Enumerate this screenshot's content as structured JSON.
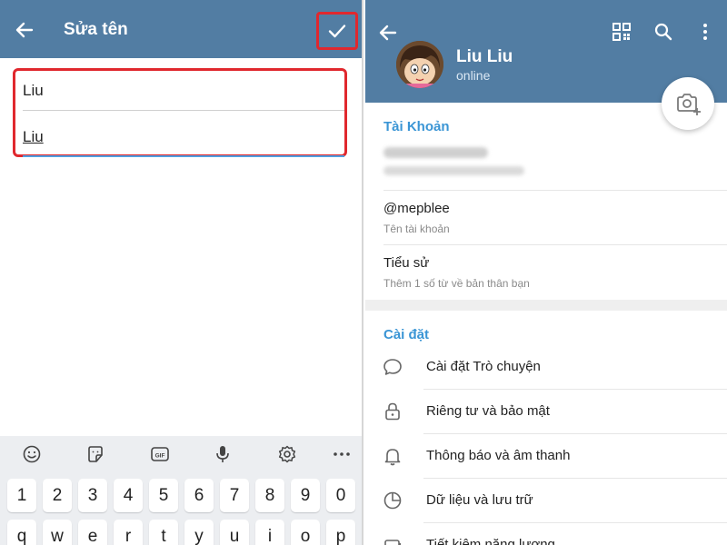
{
  "edit_name": {
    "title": "Sửa tên",
    "first_name": "Liu",
    "last_name": "Liu"
  },
  "keyboard": {
    "tools": [
      "emoji-icon",
      "sticker-icon",
      "gif-icon",
      "mic-icon",
      "settings-icon",
      "more-icon"
    ],
    "gif_label": "GIF",
    "number_row": [
      "1",
      "2",
      "3",
      "4",
      "5",
      "6",
      "7",
      "8",
      "9",
      "0"
    ],
    "letter_row": [
      "q",
      "w",
      "e",
      "r",
      "t",
      "y",
      "u",
      "i",
      "o",
      "p"
    ]
  },
  "profile": {
    "name": "Liu Liu",
    "status": "online",
    "account_section": "Tài Khoản",
    "username": "@mepblee",
    "username_caption": "Tên tài khoản",
    "bio_title": "Tiểu sử",
    "bio_caption": "Thêm 1 số từ về bản thân bạn",
    "settings_section": "Cài đặt",
    "settings_items": [
      {
        "label": "Cài đặt Trò chuyện",
        "icon": "chat-bubble-icon"
      },
      {
        "label": "Riêng tư và bảo mật",
        "icon": "lock-icon"
      },
      {
        "label": "Thông báo và âm thanh",
        "icon": "bell-icon"
      },
      {
        "label": "Dữ liệu và lưu trữ",
        "icon": "pie-chart-icon"
      },
      {
        "label": "Tiết kiệm năng lượng",
        "icon": "battery-icon"
      }
    ]
  },
  "colors": {
    "header": "#527da3",
    "accent": "#3a95d5",
    "highlight": "#e0282e"
  }
}
